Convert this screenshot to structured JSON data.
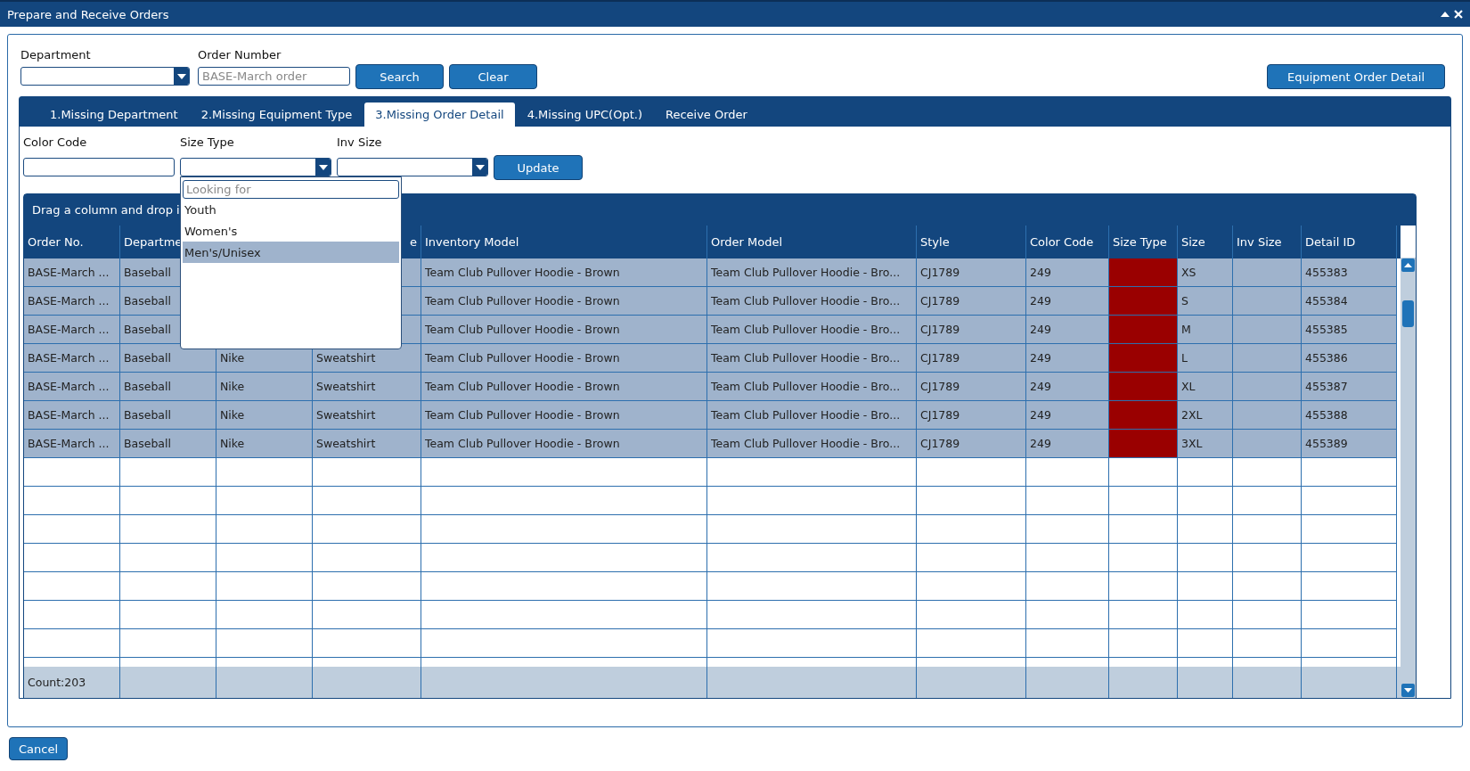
{
  "window": {
    "title": "Prepare and Receive Orders"
  },
  "search": {
    "department_label": "Department",
    "order_number_label": "Order Number",
    "order_number_placeholder": "BASE-March order",
    "buttons": [
      "Search",
      "Clear"
    ],
    "detail_button": "Equipment Order Detail"
  },
  "tabs": [
    {
      "label": "1.Missing Department",
      "selected": false
    },
    {
      "label": "2.Missing Equipment Type",
      "selected": false
    },
    {
      "label": "3.Missing Order Detail",
      "selected": true
    },
    {
      "label": "4.Missing UPC(Opt.)",
      "selected": false
    },
    {
      "label": "Receive Order",
      "selected": false
    }
  ],
  "filters": {
    "fields": [
      {
        "label": "Color Code",
        "kind": "text"
      },
      {
        "label": "Size Type",
        "kind": "select",
        "open": true
      },
      {
        "label": "Inv Size",
        "kind": "select",
        "open": false
      }
    ],
    "update_button": "Update"
  },
  "dropdown": {
    "placeholder": "Looking for",
    "options": [
      {
        "label": "Youth",
        "selected": false
      },
      {
        "label": "Women's",
        "selected": false
      },
      {
        "label": "Men's/Unisex",
        "selected": true
      }
    ]
  },
  "grid": {
    "group_hint": "Drag a column and drop i",
    "columns": [
      {
        "label": "Order No."
      },
      {
        "label": "Departme"
      },
      {},
      {
        "label": "e",
        "partly_covered": true
      },
      {
        "label": "Inventory Model"
      },
      {
        "label": "Order Model"
      },
      {
        "label": "Style"
      },
      {
        "label": "Color Code"
      },
      {
        "label": "Size Type"
      },
      {
        "label": "Size"
      },
      {
        "label": "Inv Size"
      },
      {
        "label": "Detail ID"
      }
    ],
    "rows": [
      {
        "cells": [
          "BASE-March ...",
          "Baseball",
          null,
          null,
          "Team Club Pullover Hoodie - Brown",
          "Team Club Pullover Hoodie - Bro...",
          "CJ1789",
          "249",
          null,
          "XS",
          null,
          "455383"
        ],
        "flagged": true
      },
      {
        "cells": [
          "BASE-March ...",
          "Baseball",
          null,
          null,
          "Team Club Pullover Hoodie - Brown",
          "Team Club Pullover Hoodie - Bro...",
          "CJ1789",
          "249",
          null,
          "S",
          null,
          "455384"
        ],
        "flagged": true
      },
      {
        "cells": [
          "BASE-March ...",
          "Baseball",
          null,
          null,
          "Team Club Pullover Hoodie - Brown",
          "Team Club Pullover Hoodie - Bro...",
          "CJ1789",
          "249",
          null,
          "M",
          null,
          "455385"
        ],
        "flagged": true
      },
      {
        "cells": [
          "BASE-March ...",
          "Baseball",
          "Nike",
          "Sweatshirt",
          "Team Club Pullover Hoodie - Brown",
          "Team Club Pullover Hoodie - Bro...",
          "CJ1789",
          "249",
          null,
          "L",
          null,
          "455386"
        ],
        "flagged": true
      },
      {
        "cells": [
          "BASE-March ...",
          "Baseball",
          "Nike",
          "Sweatshirt",
          "Team Club Pullover Hoodie - Brown",
          "Team Club Pullover Hoodie - Bro...",
          "CJ1789",
          "249",
          null,
          "XL",
          null,
          "455387"
        ],
        "flagged": true
      },
      {
        "cells": [
          "BASE-March ...",
          "Baseball",
          "Nike",
          "Sweatshirt",
          "Team Club Pullover Hoodie - Brown",
          "Team Club Pullover Hoodie - Bro...",
          "CJ1789",
          "249",
          null,
          "2XL",
          null,
          "455388"
        ],
        "flagged": true
      },
      {
        "cells": [
          "BASE-March ...",
          "Baseball",
          "Nike",
          "Sweatshirt",
          "Team Club Pullover Hoodie - Brown",
          "Team Club Pullover Hoodie - Bro...",
          "CJ1789",
          "249",
          null,
          "3XL",
          null,
          "455389"
        ],
        "flagged": true
      }
    ],
    "footer": {
      "count": "Count:203"
    }
  },
  "cancel_button": "Cancel"
}
